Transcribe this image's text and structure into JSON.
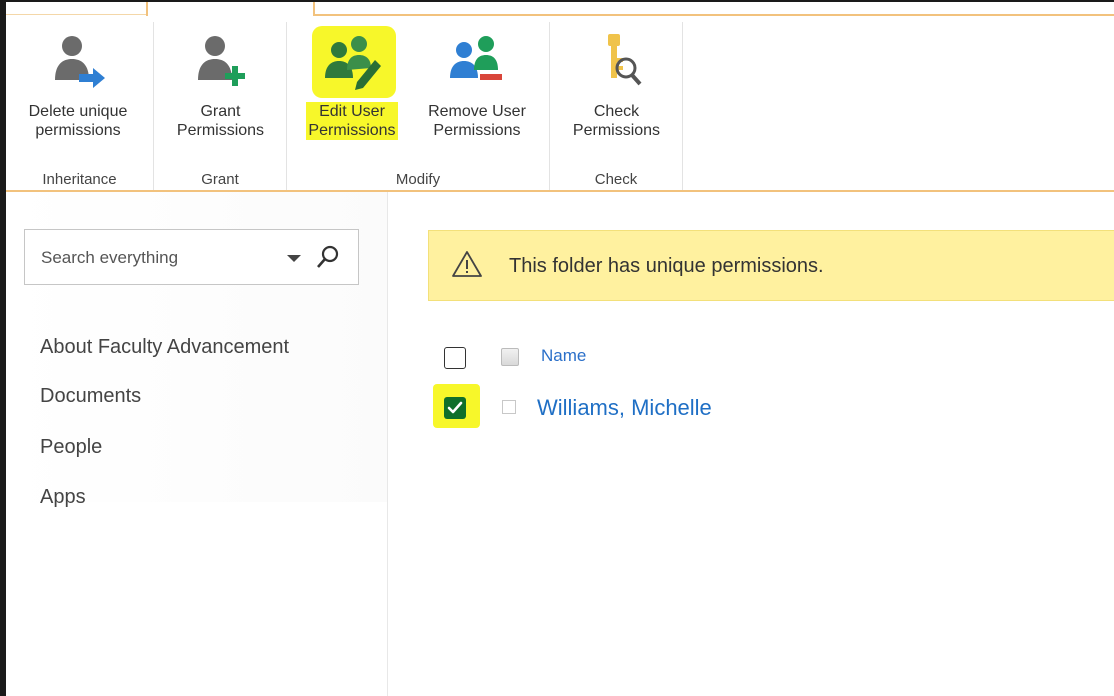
{
  "ribbon": {
    "buttons": [
      {
        "label_line1": "Delete unique",
        "label_line2": "permissions",
        "icon": "delete-unique-permissions-icon"
      },
      {
        "label_line1": "Grant",
        "label_line2": "Permissions",
        "icon": "grant-permissions-icon"
      },
      {
        "label_line1": "Edit User",
        "label_line2": "Permissions",
        "icon": "edit-user-permissions-icon"
      },
      {
        "label_line1": "Remove User",
        "label_line2": "Permissions",
        "icon": "remove-user-permissions-icon"
      },
      {
        "label_line1": "Check",
        "label_line2": "Permissions",
        "icon": "check-permissions-icon"
      }
    ],
    "groups": [
      "Inheritance",
      "Grant",
      "Modify",
      "Check"
    ]
  },
  "search": {
    "placeholder": "Search everything"
  },
  "nav": {
    "items": [
      "About Faculty Advancement",
      "Documents",
      "People",
      "Apps"
    ]
  },
  "notice": {
    "text": "This folder has unique permissions.",
    "icon": "warning-icon"
  },
  "list": {
    "header": "Name",
    "rows": [
      {
        "name": "Williams, Michelle",
        "checked": true
      }
    ]
  },
  "colors": {
    "accent_orange": "#f2c27d",
    "highlight_yellow": "#f7f72a",
    "notice_bg": "#fff19f",
    "link_blue": "#1f6fc5",
    "checkbox_green": "#0f6f2a"
  }
}
